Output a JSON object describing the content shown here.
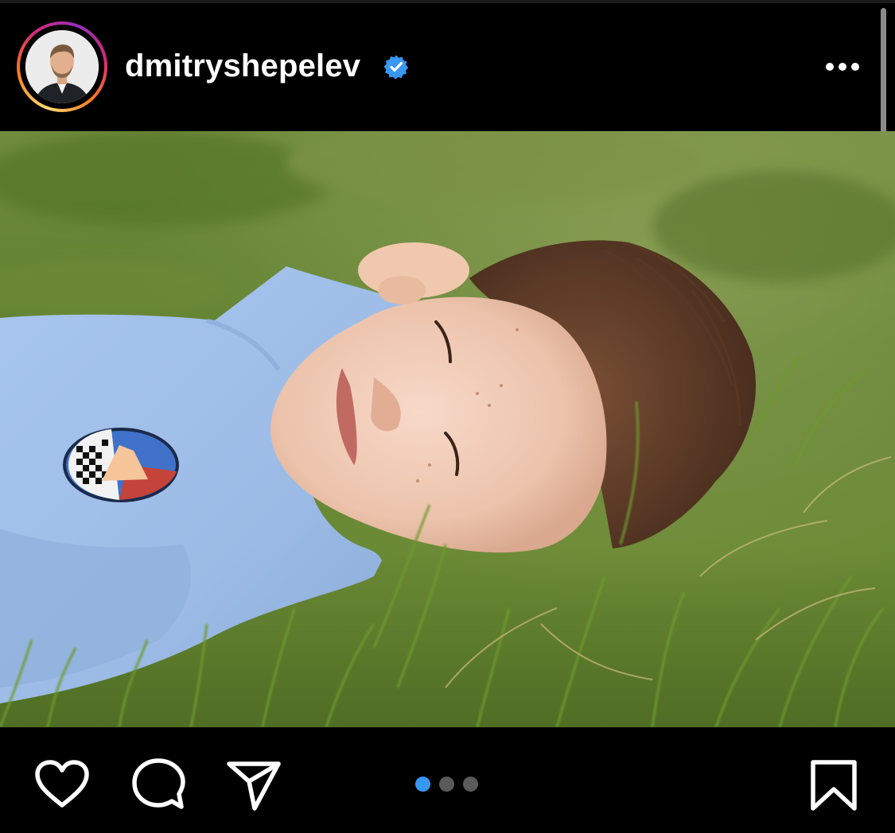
{
  "post": {
    "username": "dmitryshepelev",
    "verified": true,
    "verified_color": "#3897f0",
    "avatar_story_ring": true
  },
  "carousel": {
    "total_slides": 3,
    "current_slide": 1,
    "active_dot_color": "#3897f0"
  },
  "icons": {
    "more": "more-horizontal-icon",
    "like": "heart-icon",
    "comment": "comment-bubble-icon",
    "share": "paper-plane-icon",
    "save": "bookmark-icon",
    "verified": "verified-badge-icon"
  }
}
